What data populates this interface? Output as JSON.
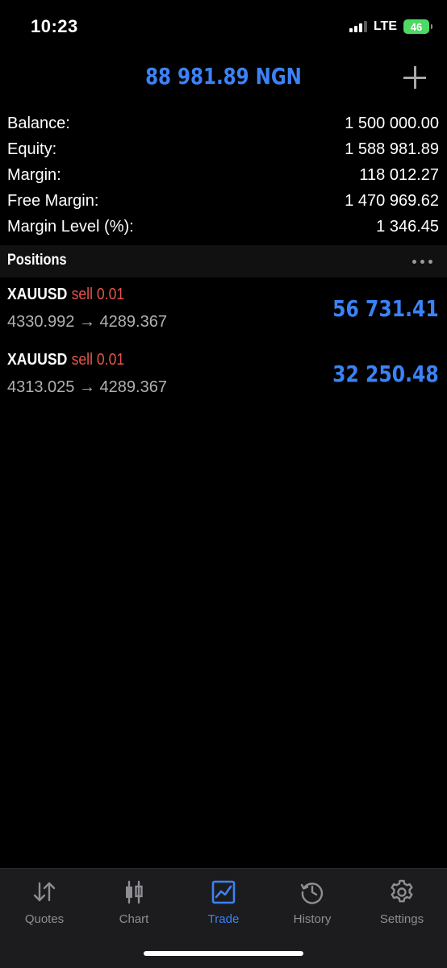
{
  "status_bar": {
    "time": "10:23",
    "network": "LTE",
    "battery": "46"
  },
  "header": {
    "title": "88 981.89 NGN",
    "add_icon": "plus-icon"
  },
  "summary": [
    {
      "label": "Balance:",
      "value": "1 500 000.00"
    },
    {
      "label": "Equity:",
      "value": "1 588 981.89"
    },
    {
      "label": "Margin:",
      "value": "118 012.27"
    },
    {
      "label": "Free Margin:",
      "value": "1 470 969.62"
    },
    {
      "label": "Margin Level (%):",
      "value": "1 346.45"
    }
  ],
  "positions": {
    "title": "Positions",
    "more_icon": "more-icon",
    "items": [
      {
        "symbol": "XAUUSD",
        "side": "sell 0.01",
        "prices": "4330.992 → 4289.367",
        "profit": "56 731.41"
      },
      {
        "symbol": "XAUUSD",
        "side": "sell 0.01",
        "prices": "4313.025 → 4289.367",
        "profit": "32 250.48"
      }
    ]
  },
  "tabs": [
    {
      "label": "Quotes",
      "icon": "quotes-icon",
      "active": false
    },
    {
      "label": "Chart",
      "icon": "candlestick-icon",
      "active": false
    },
    {
      "label": "Trade",
      "icon": "trade-chart-icon",
      "active": true
    },
    {
      "label": "History",
      "icon": "history-icon",
      "active": false
    },
    {
      "label": "Settings",
      "icon": "gear-icon",
      "active": false
    }
  ],
  "colors": {
    "accent": "#3b82f6",
    "sell": "#e5534b",
    "background": "#000000",
    "tab_bar": "#1c1c1e",
    "battery": "#4cd964"
  }
}
